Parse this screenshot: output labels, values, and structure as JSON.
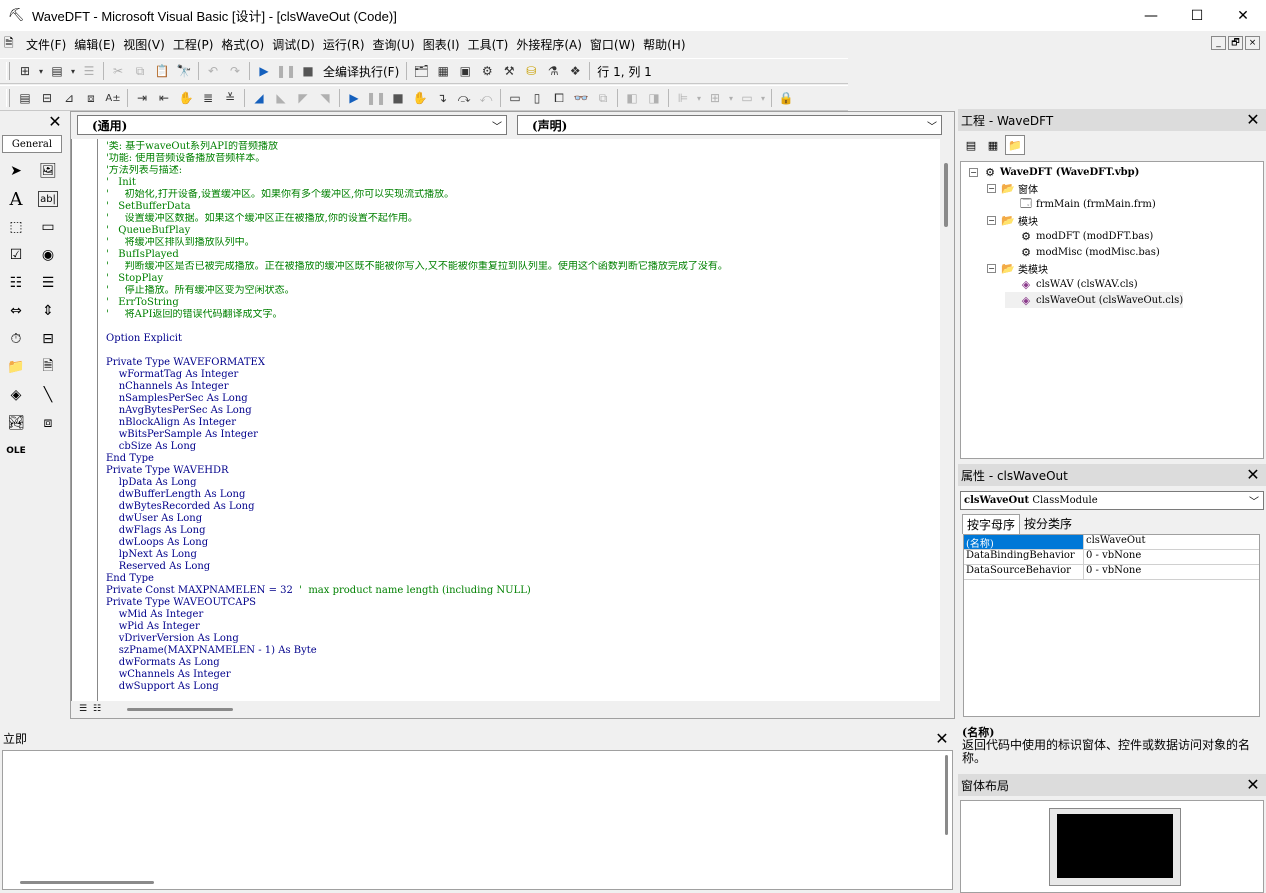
{
  "window": {
    "title": "WaveDFT - Microsoft Visual Basic [设计] - [clsWaveOut (Code)]",
    "minimize": "—",
    "maximize": "☐",
    "close": "✕"
  },
  "menu": {
    "items": [
      "文件(F)",
      "编辑(E)",
      "视图(V)",
      "工程(P)",
      "格式(O)",
      "调试(D)",
      "运行(R)",
      "查询(U)",
      "图表(I)",
      "工具(T)",
      "外接程序(A)",
      "窗口(W)",
      "帮助(H)"
    ],
    "mdi_min": "_",
    "mdi_restore": "🗗",
    "mdi_close": "×"
  },
  "toolbar1": {
    "run_full_compile": "全编译执行(F)",
    "cursor_position": "行 1, 列 1"
  },
  "toolbox": {
    "close": "✕",
    "tab": "General"
  },
  "code_window": {
    "object_combo": "(通用)",
    "procedure_combo": "(声明)",
    "lines": [
      {
        "t": "c",
        "text": "'类: 基于waveOut系列API的音频播放"
      },
      {
        "t": "c",
        "text": "'功能: 使用音频设备播放音频样本。"
      },
      {
        "t": "c",
        "text": "'方法列表与描述:"
      },
      {
        "t": "c",
        "text": "'   Init"
      },
      {
        "t": "c",
        "text": "'     初始化,打开设备,设置缓冲区。如果你有多个缓冲区,你可以实现流式播放。"
      },
      {
        "t": "c",
        "text": "'   SetBufferData"
      },
      {
        "t": "c",
        "text": "'     设置缓冲区数据。如果这个缓冲区正在被播放,你的设置不起作用。"
      },
      {
        "t": "c",
        "text": "'   QueueBufPlay"
      },
      {
        "t": "c",
        "text": "'     将缓冲区排队到播放队列中。"
      },
      {
        "t": "c",
        "text": "'   BufIsPlayed"
      },
      {
        "t": "c",
        "text": "'     判断缓冲区是否已被完成播放。正在被播放的缓冲区既不能被你写入,又不能被你重复拉到队列里。使用这个函数判断它播放完成了没有。"
      },
      {
        "t": "c",
        "text": "'   StopPlay"
      },
      {
        "t": "c",
        "text": "'     停止播放。所有缓冲区变为空闲状态。"
      },
      {
        "t": "c",
        "text": "'   ErrToString"
      },
      {
        "t": "c",
        "text": "'     将API返回的错误代码翻译成文字。"
      },
      {
        "t": "n",
        "text": ""
      },
      {
        "t": "k",
        "text": "Option Explicit"
      },
      {
        "t": "n",
        "text": ""
      },
      {
        "t": "k",
        "text": "Private Type WAVEFORMATEX"
      },
      {
        "t": "k",
        "text": "    wFormatTag As Integer"
      },
      {
        "t": "k",
        "text": "    nChannels As Integer"
      },
      {
        "t": "k",
        "text": "    nSamplesPerSec As Long"
      },
      {
        "t": "k",
        "text": "    nAvgBytesPerSec As Long"
      },
      {
        "t": "k",
        "text": "    nBlockAlign As Integer"
      },
      {
        "t": "k",
        "text": "    wBitsPerSample As Integer"
      },
      {
        "t": "k",
        "text": "    cbSize As Long"
      },
      {
        "t": "k",
        "text": "End Type"
      },
      {
        "t": "k",
        "text": "Private Type WAVEHDR"
      },
      {
        "t": "k",
        "text": "    lpData As Long"
      },
      {
        "t": "k",
        "text": "    dwBufferLength As Long"
      },
      {
        "t": "k",
        "text": "    dwBytesRecorded As Long"
      },
      {
        "t": "k",
        "text": "    dwUser As Long"
      },
      {
        "t": "k",
        "text": "    dwFlags As Long"
      },
      {
        "t": "k",
        "text": "    dwLoops As Long"
      },
      {
        "t": "k",
        "text": "    lpNext As Long"
      },
      {
        "t": "k",
        "text": "    Reserved As Long"
      },
      {
        "t": "k",
        "text": "End Type"
      },
      {
        "t": "kc",
        "text": "Private Const MAXPNAMELEN = 32",
        "comment": "  '  max product name length (including NULL)"
      },
      {
        "t": "k",
        "text": "Private Type WAVEOUTCAPS"
      },
      {
        "t": "k",
        "text": "    wMid As Integer"
      },
      {
        "t": "k",
        "text": "    wPid As Integer"
      },
      {
        "t": "k",
        "text": "    vDriverVersion As Long"
      },
      {
        "t": "k",
        "text": "    szPname(MAXPNAMELEN - 1) As Byte"
      },
      {
        "t": "k",
        "text": "    dwFormats As Long"
      },
      {
        "t": "k",
        "text": "    wChannels As Integer"
      },
      {
        "t": "k",
        "text": "    dwSupport As Long"
      }
    ]
  },
  "immediate": {
    "title": "立即",
    "close": "✕"
  },
  "project": {
    "title": "工程 - WaveDFT",
    "close": "✕",
    "tree": [
      {
        "level": 0,
        "expander": "−",
        "icon": "project",
        "label": "WaveDFT (WaveDFT.vbp)",
        "bold": true
      },
      {
        "level": 1,
        "expander": "−",
        "icon": "folder",
        "label": "窗体"
      },
      {
        "level": 2,
        "expander": "",
        "icon": "form",
        "label": "frmMain (frmMain.frm)"
      },
      {
        "level": 1,
        "expander": "−",
        "icon": "folder",
        "label": "模块"
      },
      {
        "level": 2,
        "expander": "",
        "icon": "module",
        "label": "modDFT (modDFT.bas)"
      },
      {
        "level": 2,
        "expander": "",
        "icon": "module",
        "label": "modMisc (modMisc.bas)"
      },
      {
        "level": 1,
        "expander": "−",
        "icon": "folder",
        "label": "类模块"
      },
      {
        "level": 2,
        "expander": "",
        "icon": "class",
        "label": "clsWAV (clsWAV.cls)"
      },
      {
        "level": 2,
        "expander": "",
        "icon": "class",
        "label": "clsWaveOut (clsWaveOut.cls)",
        "selected": true
      }
    ]
  },
  "properties": {
    "title": "属性 - clsWaveOut",
    "close": "✕",
    "object_name": "clsWaveOut",
    "object_type": "ClassModule",
    "tab_alpha": "按字母序",
    "tab_category": "按分类序",
    "rows": [
      {
        "name": "(名称)",
        "value": "clsWaveOut",
        "selected": true
      },
      {
        "name": "DataBindingBehavior",
        "value": "0 - vbNone"
      },
      {
        "name": "DataSourceBehavior",
        "value": "0 - vbNone"
      }
    ],
    "desc_title": "(名称)",
    "desc_text": "返回代码中使用的标识窗体、控件或数据访问对象的名称。"
  },
  "form_layout": {
    "title": "窗体布局",
    "close": "✕"
  }
}
